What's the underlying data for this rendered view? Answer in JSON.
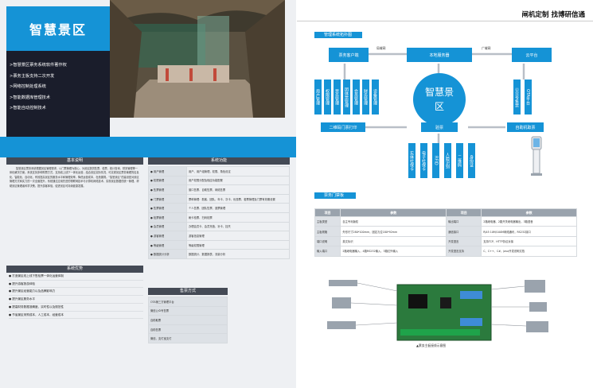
{
  "header": {
    "title": "智慧景区"
  },
  "features": [
    "智慧景区票务系统软件著作权",
    "票务主板支持二次开发",
    "网络控制处理系统",
    "智能数据库管理技术",
    "智能自动控制技术"
  ],
  "basic": {
    "title": "基本说明",
    "text": "智慧景区票务系统根据景区管理需求，以门票管理为核心，为景区提供售票、检票、统计查询、财务管理等一体化解决方案。系统支持多种购票方式，支持线上线下一体化运营，结合景区实际情况，可实现景区票务管理的信息化、智能化、自动化，有效提高景区的服务水平和管理效率，降低运营成本，杜绝漏洞。“智慧景区”的建设是对景区管理方式和实力的一次全面提升，系统通过应用先进的物联网技术与计算机网络技术，实现景区数据的统一管理，帮助景区管理者科学决策，提升游客体验，促进景区可持续健康发展。"
  },
  "advantage": {
    "title": "系统优势",
    "items": [
      "打造景区线上线下售检票一体化运营体制",
      "提升游客旅游体验",
      "提升景区经营能力以及品牌影响力",
      "提升景区服务水平",
      "提高财务数据准确度，实时性以及规范性",
      "节省景区采购成本，人工成本，经营成本"
    ]
  },
  "functions": {
    "title": "系统功能",
    "rows": [
      [
        "用户管理",
        "用户、用户组管理，权限、角色设定"
      ],
      [
        "权限管理",
        "用户权限分配及相应功能配置"
      ],
      [
        "售票管理",
        "窗口售票、自助售票、网络售票"
      ],
      [
        "门票管理",
        "票种管理：散客、团队、年卡、次卡、优惠票、套票管理及门票有效期设置"
      ],
      [
        "售票管理",
        "个人售票、团队售票、退票管理"
      ],
      [
        "检票管理",
        "刷卡检票、扫码检票"
      ],
      [
        "会员管理",
        "办理会员卡、会员充值、补卡、挂失"
      ],
      [
        "游客管理",
        "游客信息管理"
      ],
      [
        "等级管理",
        "等级权限管理"
      ],
      [
        "数据统计分析",
        "数据统计、数据报表、流量分析"
      ]
    ]
  },
  "sales": {
    "title": "售票方式",
    "items": [
      "OTA第三方管理平台",
      "微信公众号售票",
      "自助取票",
      "自助售票",
      "微信、支付宝支付"
    ]
  },
  "right": {
    "slogan": "闸机定制 找博研信通",
    "topology_title": "管理系统拓扑图",
    "nodes": {
      "client": "票务客户端",
      "server": "本地服务器",
      "cloud": "云平台",
      "lan": "局域网",
      "wan": "广域网",
      "center": "智慧景区",
      "print": "二维码门票打印",
      "check": "验票",
      "kiosk": "自助机取票"
    },
    "left_mods": [
      "用户管理",
      "权限管理",
      "票务管理",
      "团体票管理",
      "会员管理",
      "财务管理",
      "设备管理"
    ],
    "right_mods": [
      "公众号售票",
      "OTA平台"
    ],
    "bottom_mods": [
      "实体社保卡",
      "电子社保卡",
      "RFID",
      "人脸识别",
      "二维码",
      "身份证"
    ],
    "board_title": "票务门禁板",
    "board_headers": [
      "项目",
      "参数",
      "项目",
      "参数"
    ],
    "board_rows": [
      [
        "主板类型",
        "自主专利版权",
        "输出端口",
        "2路继电器、2路开关继电器输出，3路语音"
      ],
      [
        "主板规格",
        "外形尺寸280*100mm，固定孔位180*92mm",
        "通信接口",
        "RJ45 10M/100M网络通讯，RS232接口"
      ],
      [
        "端口说明",
        "英文标识",
        "开发语言",
        "支持TCP、HTTP协议对接"
      ],
      [
        "输入端口",
        "2路继电器输入，4路RS232输入，3路红外输入",
        "开发语言支持",
        "C、C++、C#、Java开发说明文档"
      ]
    ],
    "board_caption": "▲票务主板接线示意图"
  }
}
